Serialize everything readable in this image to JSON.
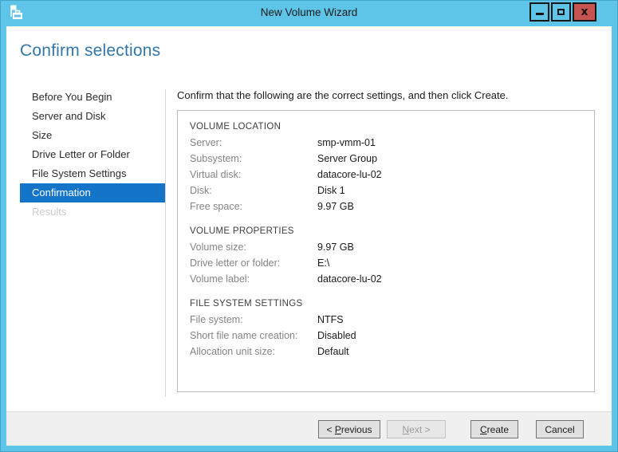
{
  "window": {
    "title": "New Volume Wizard",
    "icon": "server-manager-icon",
    "close_glyph": "x"
  },
  "page": {
    "heading": "Confirm selections"
  },
  "sidebar": {
    "items": [
      {
        "label": "Before You Begin",
        "state": "normal"
      },
      {
        "label": "Server and Disk",
        "state": "normal"
      },
      {
        "label": "Size",
        "state": "normal"
      },
      {
        "label": "Drive Letter or Folder",
        "state": "normal"
      },
      {
        "label": "File System Settings",
        "state": "normal"
      },
      {
        "label": "Confirmation",
        "state": "selected"
      },
      {
        "label": "Results",
        "state": "disabled"
      }
    ]
  },
  "content": {
    "instruction": "Confirm that the following are the correct settings, and then click Create.",
    "sections": [
      {
        "title": "VOLUME LOCATION",
        "rows": [
          {
            "label": "Server:",
            "value": "smp-vmm-01"
          },
          {
            "label": "Subsystem:",
            "value": "Server Group"
          },
          {
            "label": "Virtual disk:",
            "value": "datacore-lu-02"
          },
          {
            "label": "Disk:",
            "value": "Disk 1"
          },
          {
            "label": "Free space:",
            "value": "9.97 GB"
          }
        ]
      },
      {
        "title": "VOLUME PROPERTIES",
        "rows": [
          {
            "label": "Volume size:",
            "value": "9.97 GB"
          },
          {
            "label": "Drive letter or folder:",
            "value": "E:\\"
          },
          {
            "label": "Volume label:",
            "value": "datacore-lu-02"
          }
        ]
      },
      {
        "title": "FILE SYSTEM SETTINGS",
        "rows": [
          {
            "label": "File system:",
            "value": "NTFS"
          },
          {
            "label": "Short file name creation:",
            "value": "Disabled"
          },
          {
            "label": "Allocation unit size:",
            "value": "Default"
          }
        ]
      }
    ]
  },
  "footer": {
    "previous": {
      "prefix": "< ",
      "key": "P",
      "rest": "revious"
    },
    "next": {
      "prefix": "",
      "key": "N",
      "rest": "ext >"
    },
    "create": {
      "prefix": "",
      "key": "C",
      "rest": "reate"
    },
    "cancel": {
      "label": "Cancel"
    }
  },
  "colors": {
    "titlebar_blue": "#5ec5e8",
    "selection_blue": "#1374c8",
    "heading_blue": "#3277a8",
    "close_button_red": "#c75450"
  }
}
